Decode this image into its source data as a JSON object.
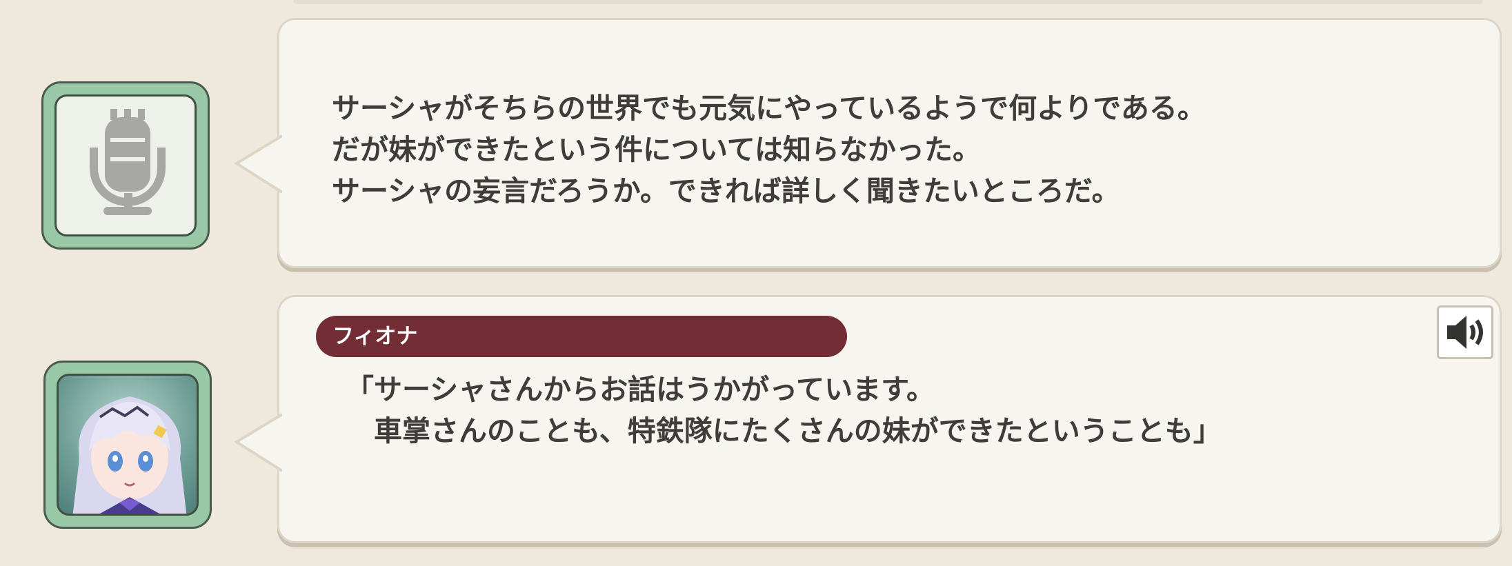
{
  "messages": [
    {
      "speaker": "",
      "avatar_icon": "microphone-icon",
      "text": "サーシャがそちらの世界でも元気にやっているようで何よりである。\nだが妹ができたという件については知らなかった。\nサーシャの妄言だろうか。できれば詳しく聞きたいところだ。",
      "has_voice": false
    },
    {
      "speaker": "フィオナ",
      "avatar_icon": "character-portrait-fiona",
      "text": "「サーシャさんからお話はうかがっています。\n　車掌さんのことも、特鉄隊にたくさんの妹ができたということも」",
      "has_voice": true,
      "voice_icon": "speaker-icon"
    }
  ],
  "colors": {
    "background": "#efe8dd",
    "bubble": "#f7f5f0",
    "avatar_frame": "#98c8a6",
    "name_plate": "#722d35",
    "text": "#3f3d39"
  }
}
